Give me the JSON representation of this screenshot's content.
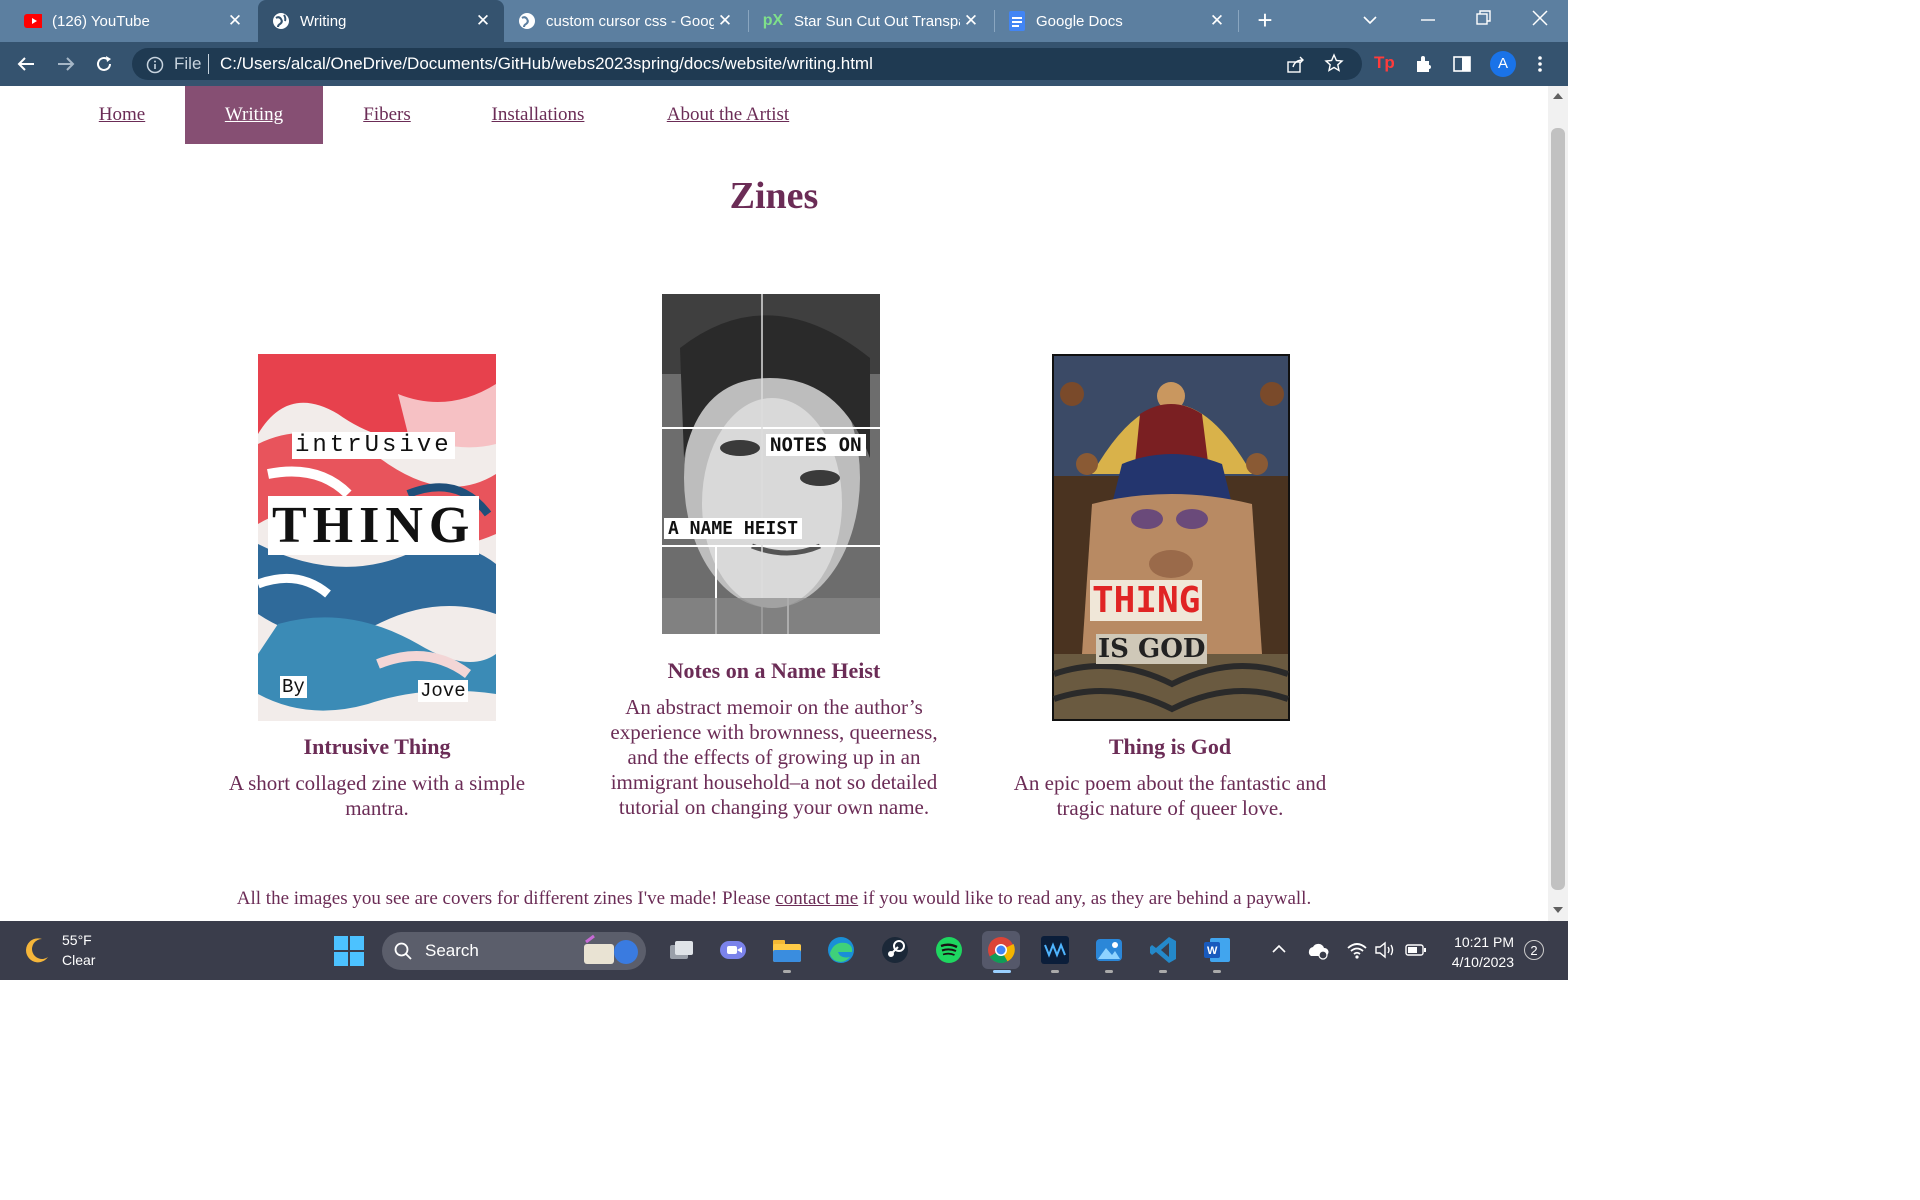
{
  "browser": {
    "tabs": [
      {
        "title": "(126) YouTube",
        "icon": "youtube-icon",
        "active": false
      },
      {
        "title": "Writing",
        "icon": "globe-icon",
        "active": true
      },
      {
        "title": "custom cursor css - Goog",
        "icon": "globe-icon",
        "active": false
      },
      {
        "title": "Star Sun Cut Out Transpar",
        "icon": "px-icon",
        "active": false
      },
      {
        "title": "Google Docs",
        "icon": "google-docs-icon",
        "active": false
      }
    ],
    "address": {
      "scheme_label": "File",
      "url": "C:/Users/alcal/OneDrive/Documents/GitHub/webs2023spring/docs/website/writing.html"
    },
    "profile_initial": "A"
  },
  "page": {
    "nav": [
      {
        "label": "Home",
        "active": false
      },
      {
        "label": "Writing",
        "active": true
      },
      {
        "label": "Fibers",
        "active": false
      },
      {
        "label": "Installations",
        "active": false
      },
      {
        "label": "About the Artist",
        "active": false
      }
    ],
    "heading": "Zines",
    "zines": [
      {
        "title": "Intrusive Thing",
        "description": "A short collaged zine with a simple mantra.",
        "cover_words": [
          "intrUsive",
          "THING",
          "By",
          "Jove"
        ]
      },
      {
        "title": "Notes on a Name Heist",
        "description": "An abstract memoir on the author’s experience with brownness, queerness, and the effects of growing up in an immigrant household–a not so detailed tutorial on changing your own name.",
        "cover_words": [
          "NOTES ON",
          "A NAME HEIST"
        ]
      },
      {
        "title": "Thing is God",
        "description": "An epic poem about the fantastic and tragic nature of queer love.",
        "cover_words": [
          "THING",
          "IS GOD"
        ]
      }
    ],
    "footer": {
      "before": "All the images you see are covers for different zines I've made! Please ",
      "link": "contact me",
      "after": " if you would like to read any, as they are behind a paywall."
    }
  },
  "taskbar": {
    "weather": {
      "temp": "55°F",
      "condition": "Clear"
    },
    "search_placeholder": "Search",
    "time": "10:21 PM",
    "date": "4/10/2023",
    "notification_count": "2"
  },
  "colors": {
    "accent": "#6b2c56",
    "nav_active": "#864f73",
    "tab_strip": "#5c7fa0",
    "toolbar": "#35536f"
  }
}
